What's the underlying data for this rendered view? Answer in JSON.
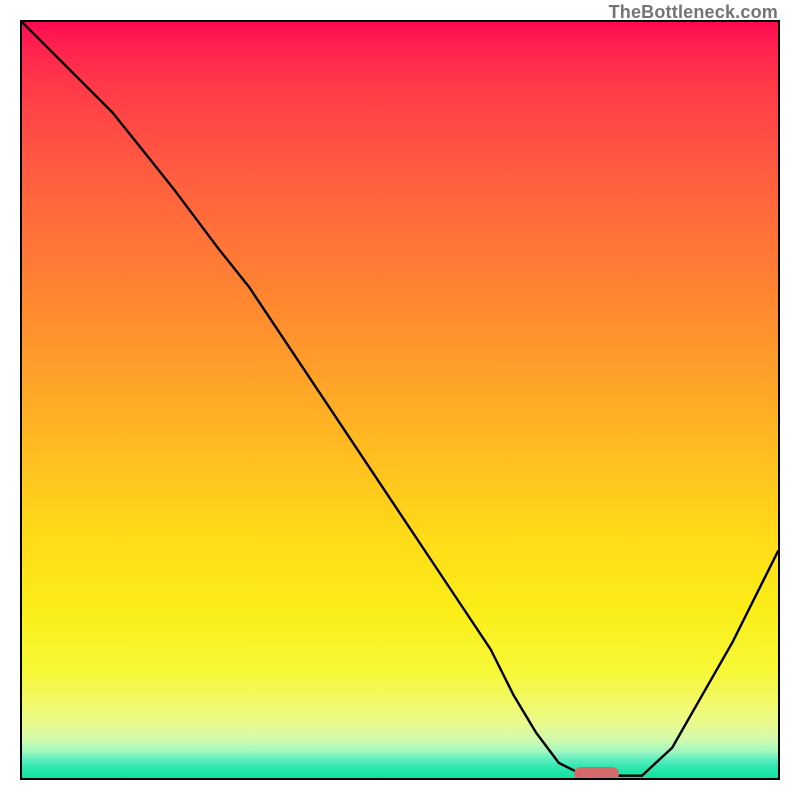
{
  "watermark": "TheBottleneck.com",
  "colors": {
    "border": "#000000",
    "curve": "#000000",
    "marker": "#d46a6a",
    "watermark_text": "#747474",
    "gradient_top": "#ff0a4f",
    "gradient_bottom": "#10e2a0"
  },
  "chart_data": {
    "type": "line",
    "title": "",
    "xlabel": "",
    "ylabel": "",
    "xlim": [
      0,
      100
    ],
    "ylim": [
      0,
      100
    ],
    "grid": false,
    "series": [
      {
        "name": "bottleneck-curve",
        "x": [
          0,
          4,
          8,
          12,
          16,
          20,
          23,
          26,
          30,
          34,
          38,
          42,
          46,
          50,
          54,
          58,
          62,
          65,
          68,
          71,
          74,
          78,
          82,
          86,
          90,
          94,
          98,
          100
        ],
        "y": [
          100,
          96,
          92,
          88,
          83,
          78,
          74,
          70,
          65,
          59,
          53,
          47,
          41,
          35,
          29,
          23,
          17,
          11,
          6,
          2,
          0.5,
          0.3,
          0.3,
          4,
          11,
          18,
          26,
          30
        ]
      }
    ],
    "marker": {
      "note": "red pill indicator near curve minimum",
      "x_center": 76,
      "y": 0.5,
      "width_pct": 6
    },
    "gradient": {
      "orientation": "vertical",
      "stops": [
        {
          "pos": 0.0,
          "color": "#ff0a4f"
        },
        {
          "pos": 0.3,
          "color": "#ff7a34"
        },
        {
          "pos": 0.6,
          "color": "#ffc81e"
        },
        {
          "pos": 0.85,
          "color": "#f6f838"
        },
        {
          "pos": 0.95,
          "color": "#c0f8b4"
        },
        {
          "pos": 1.0,
          "color": "#10e2a0"
        }
      ]
    }
  }
}
